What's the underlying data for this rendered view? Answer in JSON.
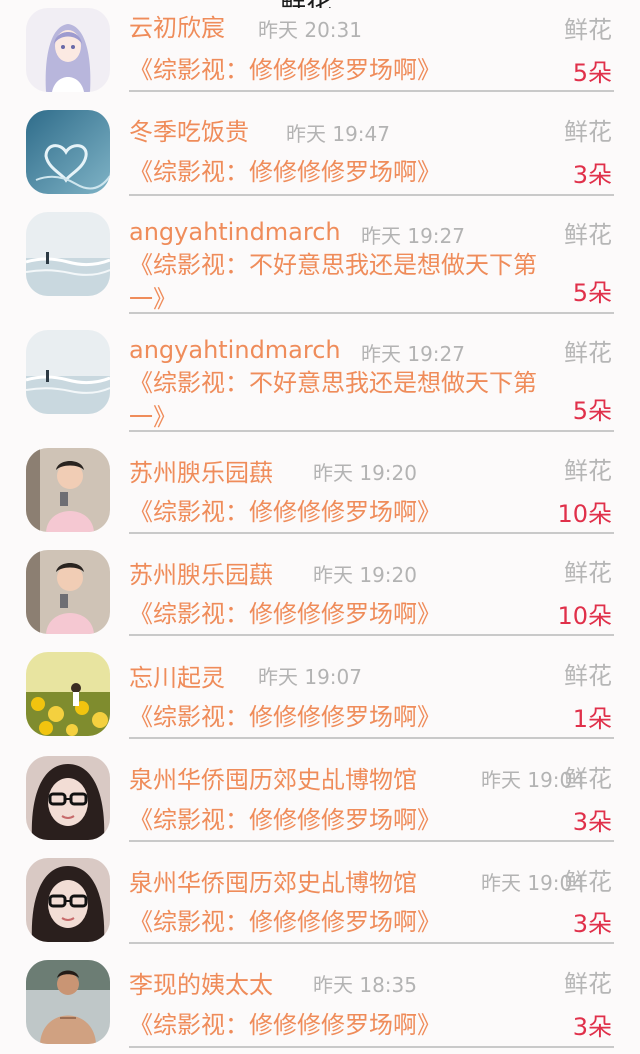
{
  "header": {
    "title": "鲜花"
  },
  "rows": [
    {
      "name": "云初欣宸",
      "time": "昨天 20:31",
      "type": "鲜花",
      "book": "《综影视：修修修修罗场啊》",
      "count": "5朵",
      "avatar": "avatar-anime-girl"
    },
    {
      "name": "冬季吃饭贵",
      "time": "昨天 19:47",
      "type": "鲜花",
      "book": "《综影视：修修修修罗场啊》",
      "count": "3朵",
      "avatar": "avatar-water-heart"
    },
    {
      "name": "angyahtindmarch",
      "time": "昨天 19:27",
      "type": "鲜花",
      "book": "《综影视：不好意思我还是想做天下第一》",
      "count": "5朵",
      "avatar": "avatar-beach"
    },
    {
      "name": "angyahtindmarch",
      "time": "昨天 19:27",
      "type": "鲜花",
      "book": "《综影视：不好意思我还是想做天下第一》",
      "count": "5朵",
      "avatar": "avatar-beach"
    },
    {
      "name": "苏州腴乐园蕻",
      "time": "昨天 19:20",
      "type": "鲜花",
      "book": "《综影视：修修修修罗场啊》",
      "count": "10朵",
      "avatar": "avatar-mirror-selfie"
    },
    {
      "name": "苏州腴乐园蕻",
      "time": "昨天 19:20",
      "type": "鲜花",
      "book": "《综影视：修修修修罗场啊》",
      "count": "10朵",
      "avatar": "avatar-mirror-selfie"
    },
    {
      "name": "忘川起灵",
      "time": "昨天 19:07",
      "type": "鲜花",
      "book": "《综影视：修修修修罗场啊》",
      "count": "1朵",
      "avatar": "avatar-sunflowers"
    },
    {
      "name": "泉州华侨囤历郊史乩博物馆",
      "time": "昨天 19:04",
      "type": "鲜花",
      "book": "《综影视：修修修修罗场啊》",
      "count": "3朵",
      "avatar": "avatar-glasses-girl"
    },
    {
      "name": "泉州华侨囤历郊史乩博物馆",
      "time": "昨天 19:04",
      "type": "鲜花",
      "book": "《综影视：修修修修罗场啊》",
      "count": "3朵",
      "avatar": "avatar-glasses-girl"
    },
    {
      "name": "李现的姨太太",
      "time": "昨天 18:35",
      "type": "鲜花",
      "book": "《综影视：修修修修罗场啊》",
      "count": "3朵",
      "avatar": "avatar-shirtless-man"
    }
  ]
}
